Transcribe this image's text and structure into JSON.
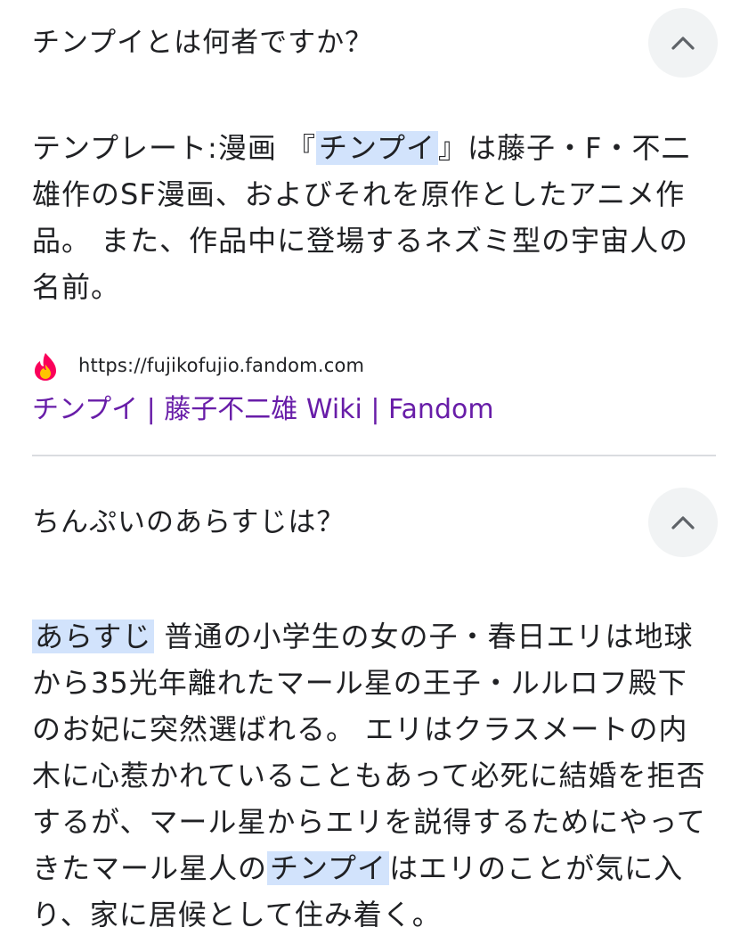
{
  "faq": [
    {
      "question": "チンプイとは何者ですか？",
      "answer_before": "テンプレート:漫画 『",
      "answer_highlight": "チンプイ",
      "answer_after": "』は藤子・F・不二雄作のSF漫画、およびそれを原作としたアニメ作品。 また、作品中に登場するネズミ型の宇宙人の名前。",
      "source": {
        "url": "https://fujikofujio.fandom.com",
        "title": "チンプイ | 藤子不二雄 Wiki | Fandom",
        "favicon_icon": "fandom-flame-icon"
      }
    },
    {
      "question": "ちんぷいのあらすじは？",
      "answer_highlight_1": "あらすじ",
      "answer_mid": " 普通の小学生の女の子・春日エリは地球から35光年離れたマール星の王子・ルルロフ殿下のお妃に突然選ばれる。 エリはクラスメートの内木に心惹かれていることもあって必死に結婚を拒否するが、マール星からエリを説得するためにやってきたマール星人の",
      "answer_highlight_2": "チンプイ",
      "answer_after": "はエリのことが気に入り、家に居候として住み着く。"
    }
  ],
  "colors": {
    "highlight": "#d2e3fc",
    "link_visited": "#681da8",
    "chevron_bg": "#f1f3f4",
    "text": "#202124",
    "divider": "#dadce0"
  }
}
